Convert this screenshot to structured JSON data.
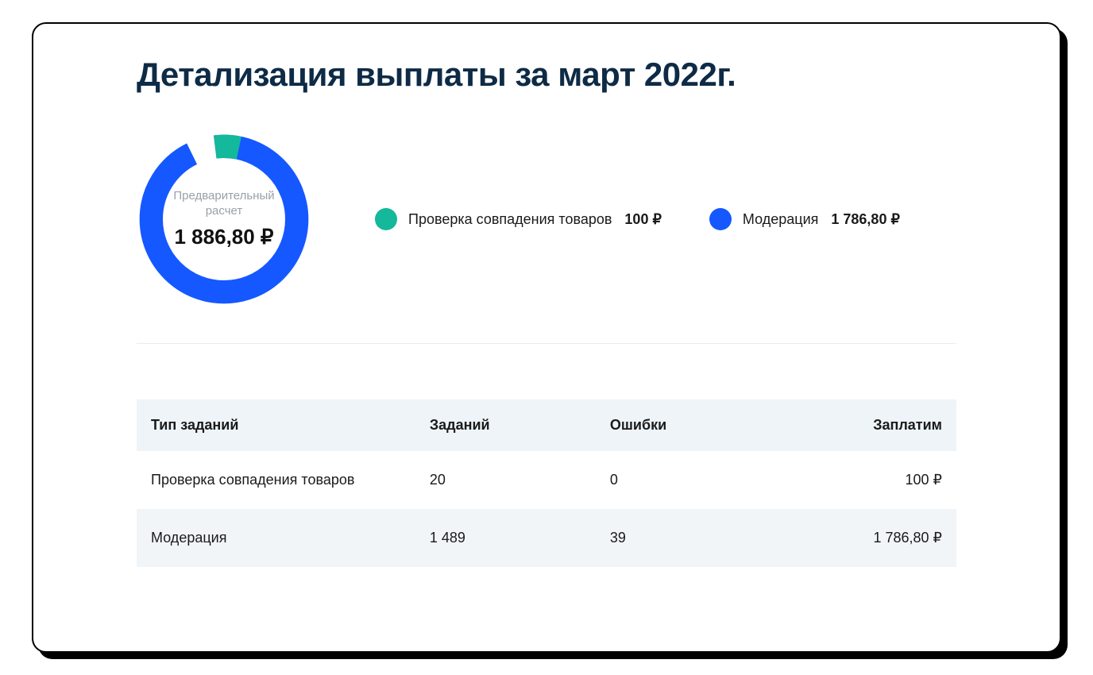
{
  "title": "Детализация выплаты за март 2022г.",
  "summary": {
    "label_line1": "Предварительный",
    "label_line2": "расчет",
    "total": "1 886,80 ₽"
  },
  "legend": [
    {
      "color": "#14b89a",
      "label": "Проверка совпадения товаров",
      "amount": "100 ₽"
    },
    {
      "color": "#1558ff",
      "label": "Модерация",
      "amount": "1 786,80 ₽"
    }
  ],
  "table": {
    "headers": [
      "Тип заданий",
      "Заданий",
      "Ошибки",
      "Заплатим"
    ],
    "rows": [
      {
        "type": "Проверка совпадения товаров",
        "tasks": "20",
        "errors": "0",
        "pay": "100 ₽"
      },
      {
        "type": "Модерация",
        "tasks": "1 489",
        "errors": "39",
        "pay": "1 786,80 ₽"
      }
    ]
  },
  "chart_data": {
    "type": "pie",
    "title": "Предварительный расчет",
    "series": [
      {
        "name": "Проверка совпадения товаров",
        "value": 100.0,
        "color": "#14b89a"
      },
      {
        "name": "Модерация",
        "value": 1786.8,
        "color": "#1558ff"
      }
    ],
    "total": 1886.8,
    "currency": "₽"
  }
}
